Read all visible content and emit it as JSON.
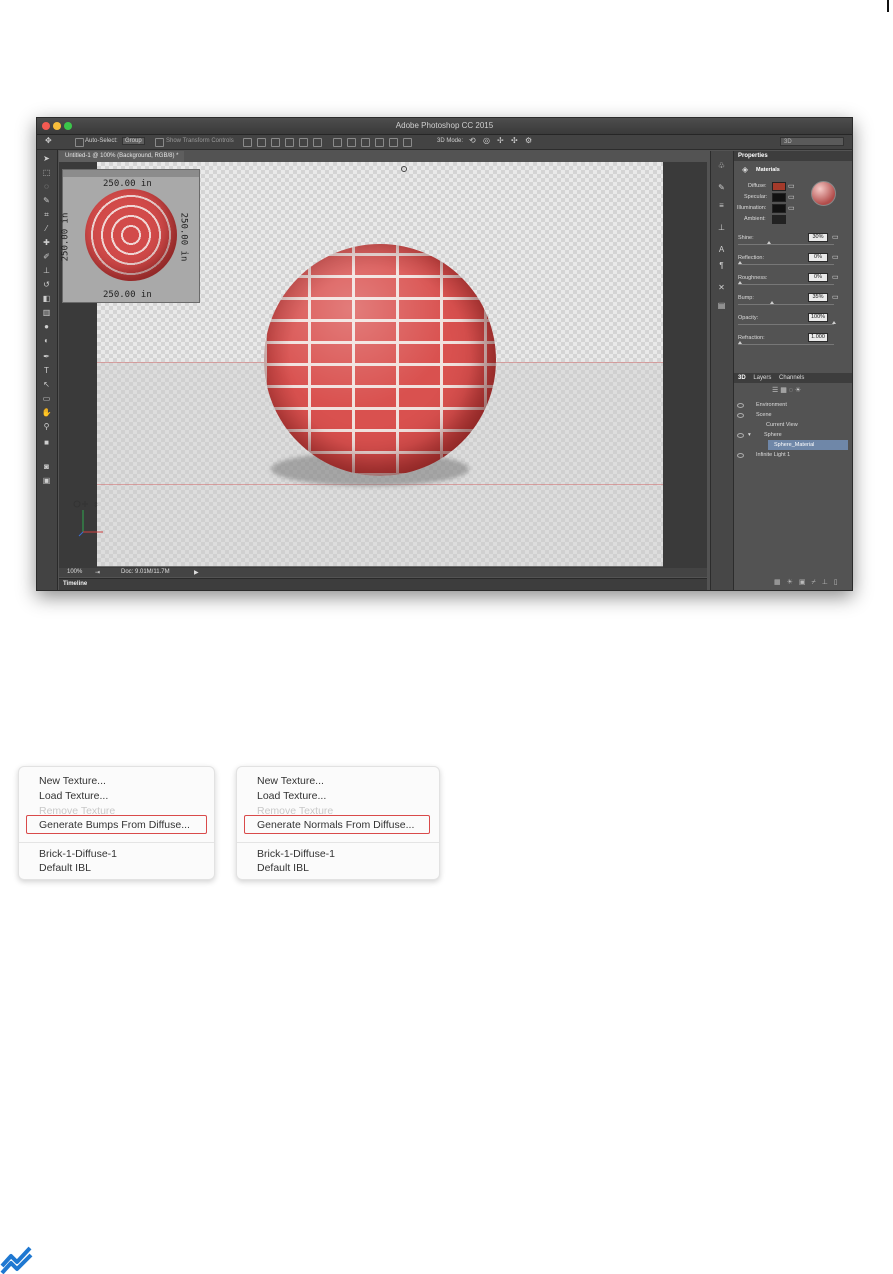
{
  "window": {
    "title": "Adobe Photoshop CC 2015",
    "document_tab": "Untitled-1 @ 100% (Background, RGB/8) *"
  },
  "options_bar": {
    "auto_select_label": "Auto-Select:",
    "auto_select_value": "Group",
    "show_transform_label": "Show Transform Controls",
    "mode_label": "3D Mode:",
    "workspace_value": "3D"
  },
  "navigator": {
    "top_dim": "250.00 in",
    "bottom_dim": "250.00 in",
    "left_dim": "250.00 in",
    "right_dim": "250.00 in"
  },
  "status_bar": {
    "zoom": "100%",
    "doc": "Doc: 9.01M/11.7M"
  },
  "timeline": {
    "label": "Timeline"
  },
  "properties": {
    "tab": "Properties",
    "section": "Materials",
    "diffuse_label": "Diffuse:",
    "diffuse_color": "#a43a2a",
    "specular_label": "Specular:",
    "illumination_label": "Illumination:",
    "ambient_label": "Ambient:",
    "shine_label": "Shine:",
    "shine_value": "30%",
    "reflection_label": "Reflection:",
    "reflection_value": "0%",
    "roughness_label": "Roughness:",
    "roughness_value": "0%",
    "bump_label": "Bump:",
    "bump_value": "35%",
    "opacity_label": "Opacity:",
    "opacity_value": "100%",
    "refraction_label": "Refraction:",
    "refraction_value": "1.000"
  },
  "layers_panel": {
    "tabs": [
      "3D",
      "Layers",
      "Channels"
    ],
    "rows": [
      "Environment",
      "Scene",
      "Current View",
      "Sphere",
      "Sphere_Material",
      "Infinite Light 1"
    ]
  },
  "menu_bumps": {
    "items": [
      "New Texture...",
      "Load Texture...",
      "Remove Texture",
      "Generate Bumps From Diffuse...",
      "Brick-1-Diffuse-1",
      "Default IBL"
    ]
  },
  "menu_normals": {
    "items": [
      "New Texture...",
      "Load Texture...",
      "Remove Texture",
      "Generate Normals From Diffuse...",
      "Brick-1-Diffuse-1",
      "Default IBL"
    ]
  },
  "colors": {
    "brick": "#d9514f",
    "highlight_box": "#d94a4a",
    "selection": "#6f87a8",
    "logo": "#1f78d1"
  }
}
